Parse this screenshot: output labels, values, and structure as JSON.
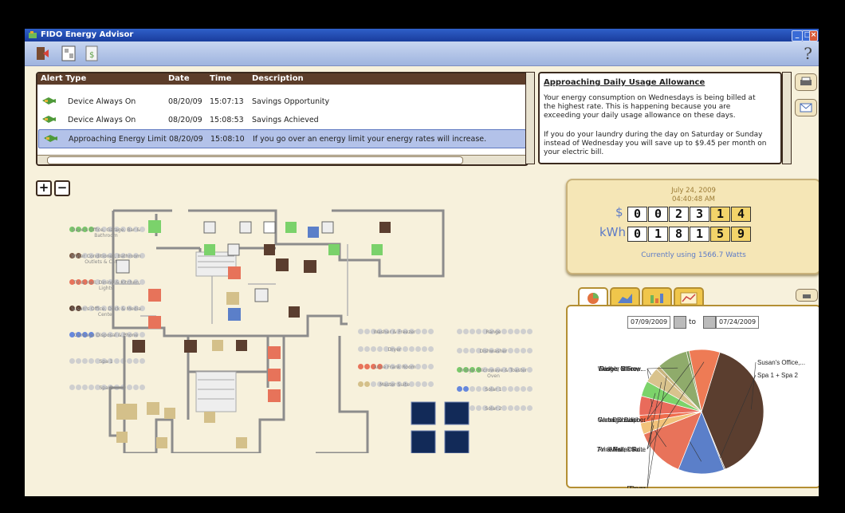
{
  "window": {
    "title": "FIDO Energy Advisor"
  },
  "alerts": {
    "columns": {
      "type": "Alert Type",
      "date": "Date",
      "time": "Time",
      "desc": "Description"
    },
    "rows": [
      {
        "type": "Device Always On",
        "date": "08/20/09",
        "time": "15:07:13",
        "desc": "Savings Opportunity"
      },
      {
        "type": "Device Always On",
        "date": "08/20/09",
        "time": "15:08:53",
        "desc": "Savings Achieved"
      },
      {
        "type": "Approaching Energy Limit",
        "date": "08/20/09",
        "time": "15:08:10",
        "desc": "If you go over an energy limit your energy rates will increase."
      }
    ],
    "selected_index": 2
  },
  "detail": {
    "title": "Approaching Daily Usage Allowance",
    "p1": "Your energy consumption on Wednesdays is being billed at the highest rate. This is happening because you are exceeding your daily usage allowance on these days.",
    "p2": "If you do your laundry during the day on Saturday or Sunday instead of Wednesday you will save up to $9.45 per month on your electric bill."
  },
  "zoom": {
    "plus": "+",
    "minus": "−"
  },
  "legend_left": [
    {
      "label": "Dave's Office, Garage, Bar & Bathroom",
      "color": "#7ac96a"
    },
    {
      "label": "Water Conditioner, Bathroom Outlets & Cat Box",
      "color": "#7a5a46"
    },
    {
      "label": "TV & Hall, Dining & Kitchen Lights",
      "color": "#e8735a"
    },
    {
      "label": "Susan's Office, Deck & Media Center",
      "color": "#5b3e2f"
    },
    {
      "label": "Garbage Disposal & Phone",
      "color": "#6688dd"
    },
    {
      "label": "Spa 1",
      "color": "#cfcfcf"
    },
    {
      "label": "Spa 2",
      "color": "#cfcfcf"
    }
  ],
  "legend_mid": [
    {
      "label": "Washer & Freezer",
      "color": "#cfcfcf"
    },
    {
      "label": "Dryer",
      "color": "#cfcfcf"
    },
    {
      "label": "Anne Frank Room",
      "color": "#e8735a"
    },
    {
      "label": "Master Suite",
      "color": "#d4c08a"
    }
  ],
  "legend_right": [
    {
      "label": "Range",
      "color": "#cfcfcf"
    },
    {
      "label": "Dishwasher",
      "color": "#cfcfcf"
    },
    {
      "label": "Fridge, Microwave & Toaster Oven",
      "color": "#7ac96a"
    },
    {
      "label": "Solar 1",
      "color": "#6688dd"
    },
    {
      "label": "Solar 2",
      "color": "#cfcfcf"
    }
  ],
  "meter": {
    "date": "July 24, 2009",
    "time": "04:40:48 AM",
    "dollar_unit": "$",
    "dollar_digits": [
      "0",
      "0",
      "2",
      "3",
      "1",
      "4"
    ],
    "kwh_unit": "kWh",
    "kwh_digits": [
      "0",
      "1",
      "8",
      "1",
      "5",
      "9"
    ],
    "usage": "Currently using 1566.7 Watts"
  },
  "chart_controls": {
    "from": "07/09/2009",
    "to_label": "to",
    "to": "07/24/2009"
  },
  "chart_data": {
    "type": "pie",
    "labels": [
      "Susan's Office,...",
      "Spa 1 + Spa 2",
      "Washer & Free...",
      "Garbage Dispo...",
      "TV & Hall, Dinn...",
      "Dryer",
      "Dave's Office, ...",
      "Water Conditio...",
      "Master Suite",
      "Range",
      "Fridge, Microw...",
      "Dishwasher",
      "Anne Frank Ro..."
    ],
    "values": [
      39,
      0.3,
      12,
      13,
      3,
      2,
      5,
      4,
      4,
      1,
      8,
      0.7,
      8
    ],
    "colors": [
      "#5b3e2f",
      "#6a6a6a",
      "#5b7fc9",
      "#e8735a",
      "#f2c27a",
      "#ef6b4b",
      "#e96b5b",
      "#7cd36a",
      "#d9c38d",
      "#c8b47e",
      "#8fab6b",
      "#7e9a5c",
      "#ee7b55"
    ]
  }
}
